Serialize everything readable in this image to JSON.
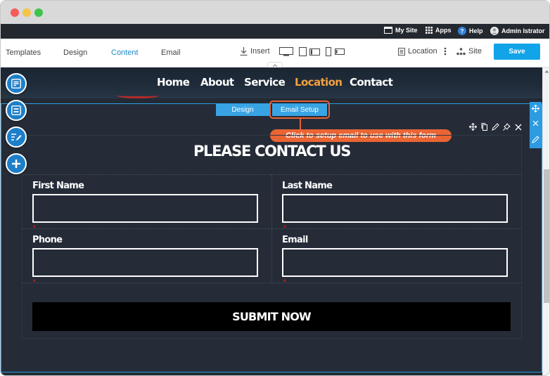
{
  "window": {
    "controls": [
      "close",
      "minimize",
      "maximize"
    ]
  },
  "admin_bar": {
    "items": [
      {
        "label": "My Site",
        "icon": "browser-window-icon"
      },
      {
        "label": "Apps",
        "icon": "grid-icon"
      },
      {
        "label": "Help",
        "icon": "help-circle-icon"
      },
      {
        "label": "Admin Istrator",
        "icon": "user-avatar-icon"
      }
    ]
  },
  "toolbar": {
    "tabs": [
      {
        "label": "Templates",
        "active": false
      },
      {
        "label": "Design",
        "active": false
      },
      {
        "label": "Content",
        "active": true
      },
      {
        "label": "Email",
        "active": false
      }
    ],
    "insert_label": "Insert",
    "devices": [
      "desktop-icon",
      "tablet-icon",
      "mobile-icon"
    ],
    "page_select_label": "Location",
    "site_label": "Site",
    "save_label": "Save"
  },
  "left_tools": [
    "page-layout-icon",
    "section-icon",
    "edit-content-icon",
    "add-icon"
  ],
  "site": {
    "nav": [
      {
        "label": "Home",
        "active": false
      },
      {
        "label": "About",
        "active": false
      },
      {
        "label": "Service",
        "active": false
      },
      {
        "label": "Location",
        "active": true
      },
      {
        "label": "Contact",
        "active": false
      }
    ],
    "section_tabs": {
      "design_label": "Design",
      "email_setup_label": "Email Setup"
    },
    "callout_text": "Click to setup email to use with this form",
    "form": {
      "title": "PLEASE CONTACT US",
      "fields": [
        {
          "label": "First Name",
          "required_mark": "*"
        },
        {
          "label": "Last Name",
          "required_mark": "*"
        },
        {
          "label": "Phone",
          "required_mark": "*"
        },
        {
          "label": "Email",
          "required_mark": "*"
        }
      ],
      "submit_label": "SUBMIT NOW"
    }
  },
  "colors": {
    "accent": "#11a4e9",
    "nav_active": "#f3a041",
    "callout": "#ea6534",
    "section_bg": "#252c38",
    "required": "#d01c1c"
  }
}
